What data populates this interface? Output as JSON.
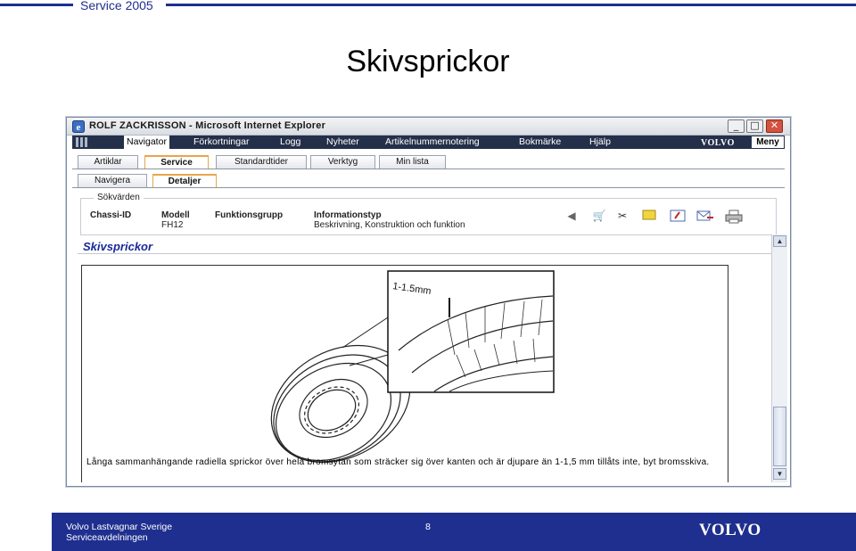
{
  "header": {
    "top_title": "Service 2005",
    "slide_title": "Skivsprickor"
  },
  "window": {
    "title": "ROLF ZACKRISSON - Microsoft Internet Explorer",
    "min_symbol": "_",
    "max_symbol": "□",
    "close_symbol": "✕"
  },
  "menubar": {
    "items": [
      "Navigator",
      "Förkortningar",
      "Logg",
      "Nyheter",
      "Artikelnummernotering",
      "Bokmärke",
      "Hjälp"
    ],
    "logo": "VOLVO",
    "meny": "Meny"
  },
  "tabs_primary": [
    "Artiklar",
    "Service",
    "Standardtider",
    "Verktyg",
    "Min lista"
  ],
  "tabs_secondary": [
    "Navigera",
    "Detaljer"
  ],
  "search": {
    "legend": "Sökvärden",
    "headers": [
      "Chassi-ID",
      "Modell",
      "Funktionsgrupp",
      "Informationstyp"
    ],
    "values": [
      "",
      "FH12",
      "",
      "Beskrivning, Konstruktion och funktion"
    ]
  },
  "toolbar_icons": [
    "back-icon",
    "cart-icon",
    "tools-icon",
    "note-icon",
    "attach-icon",
    "mail-icon",
    "print-icon"
  ],
  "content": {
    "title": "Skivsprickor",
    "measurement_label": "1-1.5mm",
    "caption": "Långa sammanhängande radiella sprickor över hela bromsytan som sträcker sig över kanten och är djupare än 1-1,5 mm tillåts inte, byt bromsskiva."
  },
  "footer": {
    "company": "Volvo Lastvagnar Sverige",
    "department": "Serviceavdelningen",
    "page_number": "8",
    "logo": "VOLVO"
  },
  "colors": {
    "brand_blue": "#1f2f8f",
    "menubar": "#24304a",
    "content_title": "#1a2a9a",
    "tab_active": "#e8a64a"
  }
}
